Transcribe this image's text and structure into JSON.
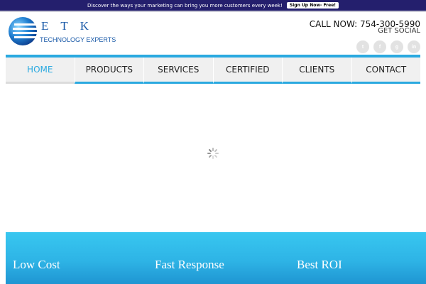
{
  "promo": {
    "text": "Discover the ways your marketing can bring you more customers every week!",
    "button": "Sign Up Now- Free!"
  },
  "logo": {
    "letters": "ETK",
    "subtitle": "TECHNOLOGY EXPERTS"
  },
  "header": {
    "call": "CALL NOW: 754-300-5990",
    "social_label": "GET SOCIAL",
    "social_icons": [
      "twitter-icon",
      "facebook-icon",
      "google-plus-icon",
      "linkedin-icon"
    ]
  },
  "nav": {
    "items": [
      {
        "label": "HOME",
        "active": true
      },
      {
        "label": "PRODUCTS",
        "active": false
      },
      {
        "label": "SERVICES",
        "active": false
      },
      {
        "label": "CERTIFIED",
        "active": false
      },
      {
        "label": "CLIENTS",
        "active": false
      },
      {
        "label": "CONTACT",
        "active": false
      }
    ]
  },
  "features": [
    "Low Cost",
    "Fast Response",
    "Best ROI"
  ],
  "colors": {
    "promo_bg": "#241f6d",
    "accent": "#2aa9e0",
    "band_top": "#38c7f0",
    "band_bottom": "#1f95d2",
    "logo_blue": "#1a5aa8"
  }
}
